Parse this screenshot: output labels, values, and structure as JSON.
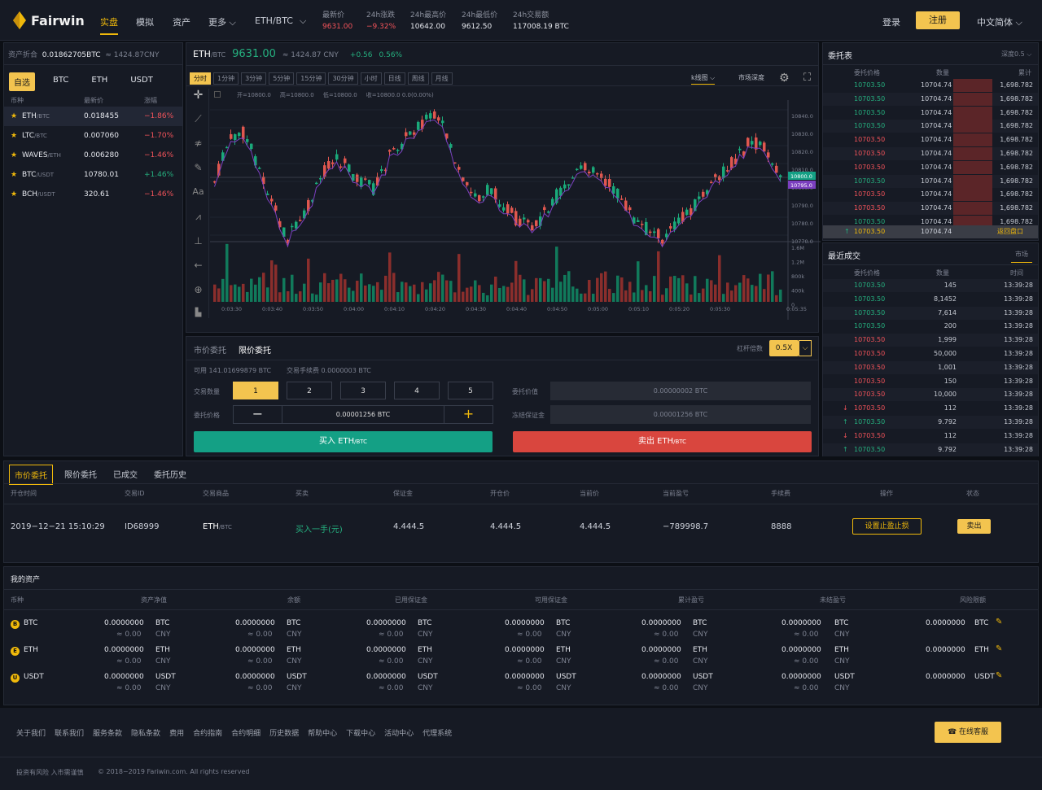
{
  "header": {
    "logo": "Fairwin",
    "nav": [
      "实盘",
      "模拟",
      "资产",
      "更多"
    ],
    "pair": "ETH/BTC",
    "stats": [
      {
        "label": "最新价",
        "value": "9631.00",
        "color": "red"
      },
      {
        "label": "24h涨跌",
        "value": "−9.32%",
        "color": "red"
      },
      {
        "label": "24h最高价",
        "value": "10642.00",
        "color": "white"
      },
      {
        "label": "24h最低价",
        "value": "9612.50",
        "color": "white"
      },
      {
        "label": "24h交易额",
        "value": "117008.19 BTC",
        "color": "white"
      }
    ],
    "login": "登录",
    "register": "注册",
    "language": "中文简体"
  },
  "assets_summary": {
    "label": "资产折合",
    "btc": "0.01862705BTC",
    "approx": "≈",
    "cny": "1424.87CNY"
  },
  "market": {
    "tabs": [
      "自选",
      "BTC",
      "ETH",
      "USDT"
    ],
    "headers": [
      "币种",
      "最新价",
      "涨幅"
    ],
    "rows": [
      {
        "coin": "ETH",
        "quote": "/BTC",
        "price": "0.018455",
        "change": "−1.86%"
      },
      {
        "coin": "LTC",
        "quote": "/BTC",
        "price": "0.007060",
        "change": "−1.70%"
      },
      {
        "coin": "WAVES",
        "quote": "/ETH",
        "price": "0.006280",
        "change": "−1.46%"
      },
      {
        "coin": "BTC",
        "quote": "/USDT",
        "price": "10780.01",
        "change": "+1.46%"
      },
      {
        "coin": "BCH",
        "quote": "/USDT",
        "price": "320.61",
        "change": "−1.46%"
      }
    ]
  },
  "chart_header": {
    "pair": "ETH",
    "quote": "/BTC",
    "price": "9631.00",
    "approx": "≈ 1424.87 CNY",
    "change": "+0.56",
    "pct": "0.56%"
  },
  "chart_toolbar": {
    "intervals": [
      "分时",
      "1分钟",
      "3分钟",
      "5分钟",
      "15分钟",
      "30分钟",
      "小时",
      "日线",
      "周线",
      "月线"
    ],
    "kline": "k线图",
    "depth": "市场深度"
  },
  "ohlc": "开=10800.0     高=10800.0     低=10800.0     收=10800.0 0.0(0.00%)",
  "chart_data": {
    "type": "bar",
    "title": "",
    "price_axis": [
      "10840.0",
      "10830.0",
      "10820.0",
      "10810.0",
      "10800.0",
      "10790.0",
      "10780.0",
      "10770.0"
    ],
    "price_tags": [
      "10800.0",
      "10795.0"
    ],
    "volume_axis": [
      "1.6M",
      "1.2M",
      "800k",
      "400k",
      "0"
    ],
    "time_axis": [
      "0:03:30",
      "0:03:40",
      "0:03:50",
      "0:04:00",
      "0:04:10",
      "0:04:20",
      "0:04:30",
      "0:04:40",
      "0:04:50",
      "0:05:00",
      "0:05:10",
      "0:05:20",
      "0:05:30",
      "0:05:35"
    ]
  },
  "order_form": {
    "tabs": [
      "市价委托",
      "限价委托"
    ],
    "leverage_label": "杠杆倍数",
    "leverage": "0.5X",
    "available": "可用  141.01699879 BTC",
    "fee": "交易手续费  0.0000003 BTC",
    "qty_label": "交易数量",
    "qty": [
      "1",
      "2",
      "3",
      "4",
      "5"
    ],
    "price_label": "委托价格",
    "price_value": "0.00001256 BTC",
    "order_value_label": "委托价值",
    "order_value": "0.00000002 BTC",
    "margin_label": "冻结保证金",
    "margin": "0.00001256 BTC",
    "buy": "买入 ETH",
    "buy_q": "/BTC",
    "sell": "卖出 ETH",
    "sell_q": "/BTC"
  },
  "orderbook": {
    "title": "委托表",
    "depth": "深度0.5",
    "headers": [
      "委托价格",
      "数量",
      "累计"
    ],
    "rows": [
      {
        "p": "10703.50",
        "q": "10704.74",
        "c": "1,698.782",
        "s": "buy"
      },
      {
        "p": "10703.50",
        "q": "10704.74",
        "c": "1,698.782",
        "s": "buy"
      },
      {
        "p": "10703.50",
        "q": "10704.74",
        "c": "1,698.782",
        "s": "buy"
      },
      {
        "p": "10703.50",
        "q": "10704.74",
        "c": "1,698.782",
        "s": "buy"
      },
      {
        "p": "10703.50",
        "q": "10704.74",
        "c": "1,698.782",
        "s": "sell"
      },
      {
        "p": "10703.50",
        "q": "10704.74",
        "c": "1,698.782",
        "s": "sell"
      },
      {
        "p": "10703.50",
        "q": "10704.74",
        "c": "1,698.782",
        "s": "sell"
      },
      {
        "p": "10703.50",
        "q": "10704.74",
        "c": "1,698.782",
        "s": "buy"
      },
      {
        "p": "10703.50",
        "q": "10704.74",
        "c": "1,698.782",
        "s": "sell"
      },
      {
        "p": "10703.50",
        "q": "10704.74",
        "c": "1,698.782",
        "s": "sell"
      },
      {
        "p": "10703.50",
        "q": "10704.74",
        "c": "1,698.782",
        "s": "buy"
      }
    ],
    "last": {
      "p": "10703.50",
      "q": "10704.74",
      "back": "返回盘口"
    }
  },
  "trades": {
    "title": "最近成交",
    "tab": "市场",
    "headers": [
      "委托价格",
      "数量",
      "时间"
    ],
    "rows": [
      {
        "p": "10703.50",
        "q": "145",
        "t": "13:39:28",
        "s": "buy",
        "a": ""
      },
      {
        "p": "10703.50",
        "q": "8,1452",
        "t": "13:39:28",
        "s": "buy",
        "a": ""
      },
      {
        "p": "10703.50",
        "q": "7,614",
        "t": "13:39:28",
        "s": "buy",
        "a": ""
      },
      {
        "p": "10703.50",
        "q": "200",
        "t": "13:39:28",
        "s": "buy",
        "a": ""
      },
      {
        "p": "10703.50",
        "q": "1,999",
        "t": "13:39:28",
        "s": "sell",
        "a": ""
      },
      {
        "p": "10703.50",
        "q": "50,000",
        "t": "13:39:28",
        "s": "sell",
        "a": ""
      },
      {
        "p": "10703.50",
        "q": "1,001",
        "t": "13:39:28",
        "s": "sell",
        "a": ""
      },
      {
        "p": "10703.50",
        "q": "150",
        "t": "13:39:28",
        "s": "sell",
        "a": ""
      },
      {
        "p": "10703.50",
        "q": "10,000",
        "t": "13:39:28",
        "s": "sell",
        "a": ""
      },
      {
        "p": "10703.50",
        "q": "112",
        "t": "13:39:28",
        "s": "sell",
        "a": "↓"
      },
      {
        "p": "10703.50",
        "q": "9.792",
        "t": "13:39:28",
        "s": "buy",
        "a": "↑"
      },
      {
        "p": "10703.50",
        "q": "112",
        "t": "13:39:28",
        "s": "sell",
        "a": "↓"
      },
      {
        "p": "10703.50",
        "q": "9.792",
        "t": "13:39:28",
        "s": "buy",
        "a": "↑"
      }
    ]
  },
  "positions": {
    "tabs": [
      "市价委托",
      "限价委托",
      "已成交",
      "委托历史"
    ],
    "headers": [
      "开仓时间",
      "交易ID",
      "交易商品",
      "买卖",
      "保证金",
      "开仓价",
      "当前价",
      "当前盈亏",
      "手续费",
      "操作",
      "状态"
    ],
    "row": {
      "time": "2019−12−21   15:10:29",
      "id": "ID68999",
      "product": "ETH",
      "product_q": "/BTC",
      "side": "买入一手(元)",
      "margin": "4.444.5",
      "open": "4.444.5",
      "current": "4.444.5",
      "pnl": "−789998.7",
      "fee": "8888",
      "action": "设置止盈止损",
      "status": "卖出"
    }
  },
  "my_assets": {
    "title": "我的资产",
    "headers": [
      "币种",
      "资产净值",
      "余额",
      "已用保证金",
      "可用保证金",
      "累计盈亏",
      "未结盈亏",
      "风险限额"
    ],
    "rows": [
      {
        "coin": "BTC",
        "icon": "B",
        "value": "0.0000000",
        "approx": "≈ 0.00",
        "cny": "CNY"
      },
      {
        "coin": "ETH",
        "icon": "E",
        "value": "0.0000000",
        "approx": "≈ 0.00",
        "cny": "CNY"
      },
      {
        "coin": "USDT",
        "icon": "U",
        "value": "0.0000000",
        "approx": "≈ 0.00",
        "cny": "CNY"
      }
    ]
  },
  "footer": {
    "links": [
      "关于我们",
      "联系我们",
      "服务条款",
      "隐私条款",
      "费用",
      "合约指南",
      "合约明细",
      "历史数据",
      "帮助中心",
      "下载中心",
      "活动中心",
      "代理系统"
    ],
    "support": "在线客服",
    "risk": "投资有风险 入市需谨慎",
    "copyright": "© 2018−2019 Fariwin.com. All rights reserved"
  }
}
